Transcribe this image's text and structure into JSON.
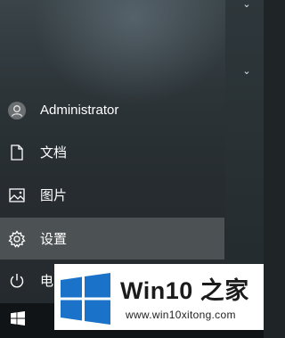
{
  "start_menu": {
    "items": [
      {
        "label": "Administrator",
        "icon": "user-avatar-icon"
      },
      {
        "label": "文档",
        "icon": "document-icon"
      },
      {
        "label": "图片",
        "icon": "pictures-icon"
      },
      {
        "label": "设置",
        "icon": "gear-icon"
      },
      {
        "label": "电",
        "icon": "power-icon"
      }
    ],
    "right_column_icons": [
      "chevron-down-icon",
      "chevron-down-icon"
    ]
  },
  "taskbar": {
    "start_icon": "windows-logo-icon"
  },
  "watermark": {
    "title": "Win10 之家",
    "url": "www.win10xitong.com"
  },
  "colors": {
    "menu_bg": "#262c2f",
    "hover_bg": "#5a6063",
    "watermark_blue": "#1a73c8",
    "taskbar_bg": "#111417"
  }
}
